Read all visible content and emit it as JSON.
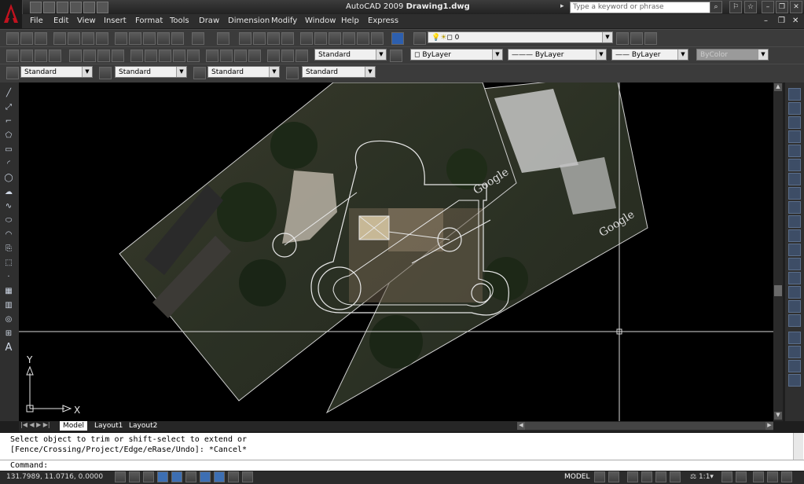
{
  "app": {
    "title_app": "AutoCAD 2009",
    "title_doc": "Drawing1.dwg",
    "search_placeholder": "Type a keyword or phrase",
    "window_controls": [
      "minimize-icon",
      "restore-icon",
      "close-icon"
    ]
  },
  "menu": [
    "File",
    "Edit",
    "View",
    "Insert",
    "Format",
    "Tools",
    "Draw",
    "Dimension",
    "Modify",
    "Window",
    "Help",
    "Express"
  ],
  "toolbars": {
    "layer_value": "0",
    "dim_style": "Standard",
    "color": "ByLayer",
    "linetype": "ByLayer",
    "lineweight": "ByLayer",
    "plotstyle": "ByColor",
    "text_style": "Standard",
    "dim_style2": "Standard",
    "table_style": "Standard",
    "multileader_style": "Standard"
  },
  "canvas": {
    "watermark1": "Google",
    "watermark2": "Google",
    "ucs_x": "X",
    "ucs_y": "Y"
  },
  "tabs": [
    "Model",
    "Layout1",
    "Layout2"
  ],
  "command": {
    "line1": "Select object to trim or shift-select to extend or",
    "line2": "[Fence/Crossing/Project/Edge/eRase/Undo]: *Cancel*",
    "prompt": "Command:"
  },
  "status": {
    "coords": "131.7989, 11.0716, 0.0000",
    "model_label": "MODEL",
    "scale": "1:1"
  },
  "colors": {
    "background": "#000000",
    "ui_dark": "#3b3b3b",
    "accent_logo": "#c1121f"
  }
}
